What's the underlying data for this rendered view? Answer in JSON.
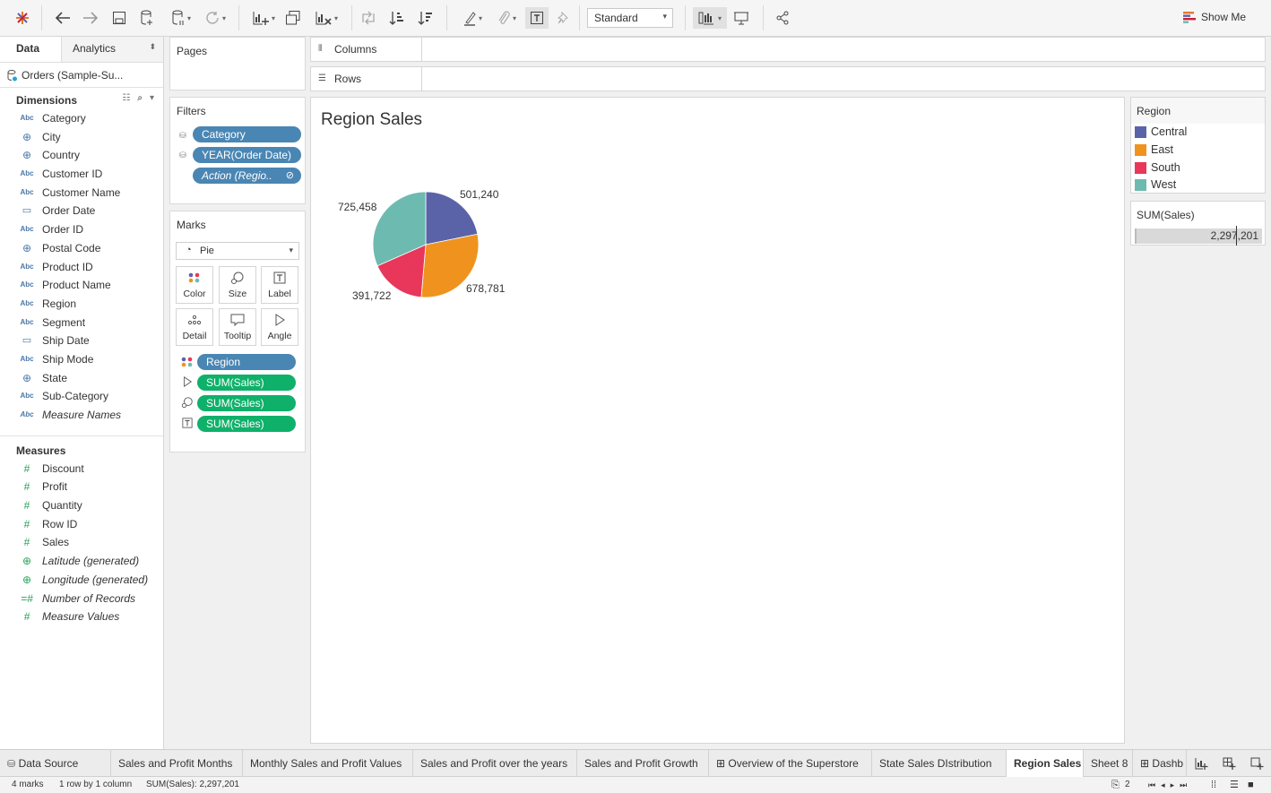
{
  "toolbar": {
    "view_size": "Standard",
    "show_me": "Show Me"
  },
  "data_pane": {
    "tab_data": "Data",
    "tab_analytics": "Analytics",
    "datasource": "Orders (Sample-Su...",
    "dimensions_title": "Dimensions",
    "dimensions": [
      {
        "icon": "Abc",
        "name": "Category",
        "italic": false
      },
      {
        "icon": "globe",
        "name": "City",
        "italic": false
      },
      {
        "icon": "globe",
        "name": "Country",
        "italic": false
      },
      {
        "icon": "Abc",
        "name": "Customer ID",
        "italic": false
      },
      {
        "icon": "Abc",
        "name": "Customer Name",
        "italic": false
      },
      {
        "icon": "calendar",
        "name": "Order Date",
        "italic": false
      },
      {
        "icon": "Abc",
        "name": "Order ID",
        "italic": false
      },
      {
        "icon": "globe",
        "name": "Postal Code",
        "italic": false
      },
      {
        "icon": "Abc",
        "name": "Product ID",
        "italic": false
      },
      {
        "icon": "Abc",
        "name": "Product Name",
        "italic": false
      },
      {
        "icon": "Abc",
        "name": "Region",
        "italic": false
      },
      {
        "icon": "Abc",
        "name": "Segment",
        "italic": false
      },
      {
        "icon": "calendar",
        "name": "Ship Date",
        "italic": false
      },
      {
        "icon": "Abc",
        "name": "Ship Mode",
        "italic": false
      },
      {
        "icon": "globe",
        "name": "State",
        "italic": false
      },
      {
        "icon": "Abc",
        "name": "Sub-Category",
        "italic": false
      },
      {
        "icon": "Abc",
        "name": "Measure Names",
        "italic": true
      }
    ],
    "measures_title": "Measures",
    "measures": [
      {
        "icon": "hash",
        "name": "Discount",
        "italic": false
      },
      {
        "icon": "hash",
        "name": "Profit",
        "italic": false
      },
      {
        "icon": "hash",
        "name": "Quantity",
        "italic": false
      },
      {
        "icon": "hash",
        "name": "Row ID",
        "italic": false
      },
      {
        "icon": "hash",
        "name": "Sales",
        "italic": false
      },
      {
        "icon": "globe-green",
        "name": "Latitude (generated)",
        "italic": true
      },
      {
        "icon": "globe-green",
        "name": "Longitude (generated)",
        "italic": true
      },
      {
        "icon": "hash-calc",
        "name": "Number of Records",
        "italic": true
      },
      {
        "icon": "hash",
        "name": "Measure Values",
        "italic": true
      }
    ]
  },
  "shelves": {
    "pages": "Pages",
    "filters": "Filters",
    "filter_pills": [
      "Category",
      "YEAR(Order Date)",
      "Action (Regio.."
    ],
    "marks": "Marks",
    "mark_type": "Pie",
    "mark_buttons": [
      "Color",
      "Size",
      "Label",
      "Detail",
      "Tooltip",
      "Angle"
    ],
    "mark_pills": [
      "Region",
      "SUM(Sales)",
      "SUM(Sales)",
      "SUM(Sales)"
    ],
    "columns": "Columns",
    "rows": "Rows"
  },
  "view": {
    "title": "Region Sales"
  },
  "legend": {
    "title": "Region",
    "items": [
      {
        "name": "Central",
        "color": "#5b63a8"
      },
      {
        "name": "East",
        "color": "#ef931e"
      },
      {
        "name": "South",
        "color": "#e8375a"
      },
      {
        "name": "West",
        "color": "#6dbab0"
      }
    ]
  },
  "sum_card": {
    "title": "SUM(Sales)",
    "value": "2,297,201"
  },
  "chart_data": {
    "type": "pie",
    "categories": [
      "Central",
      "East",
      "South",
      "West"
    ],
    "values": [
      501240,
      678781,
      391722,
      725458
    ],
    "labels": [
      "501,240",
      "678,781",
      "391,722",
      "725,458"
    ],
    "colors": [
      "#5b63a8",
      "#ef931e",
      "#e8375a",
      "#6dbab0"
    ],
    "title": "Region Sales"
  },
  "sheet_tabs": [
    {
      "label": "Data Source",
      "active": false
    },
    {
      "label": "Sales and Profit Months",
      "active": false
    },
    {
      "label": "Monthly Sales and Profit Values",
      "active": false
    },
    {
      "label": "Sales and Profit over the years",
      "active": false
    },
    {
      "label": "Sales and Profit Growth",
      "active": false
    },
    {
      "label": "Overview of the Superstore",
      "active": false
    },
    {
      "label": "State Sales DIstribution",
      "active": false
    },
    {
      "label": "Region Sales",
      "active": true
    },
    {
      "label": "Sheet 8",
      "active": false
    },
    {
      "label": "Dashb",
      "active": false
    }
  ],
  "status": {
    "marks": "4 marks",
    "shape": "1 row by 1 column",
    "sum": "SUM(Sales): 2,297,201",
    "selected": "2"
  }
}
